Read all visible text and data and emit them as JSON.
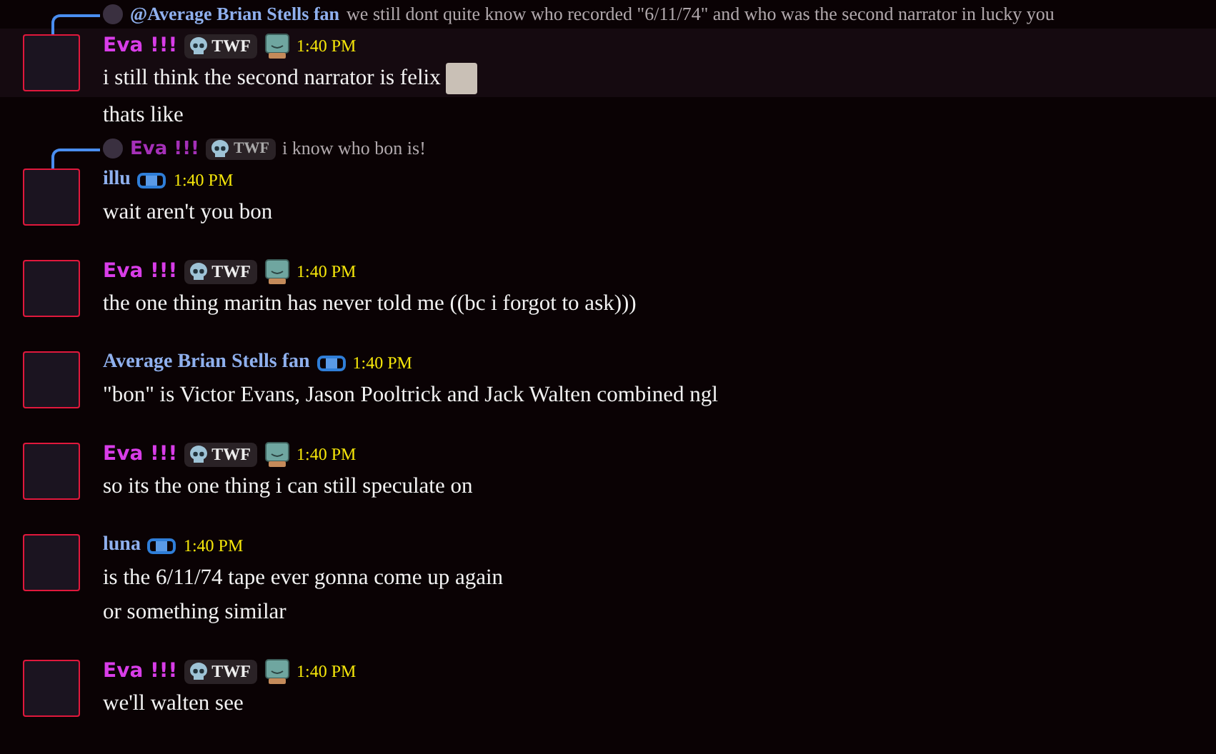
{
  "messages": [
    {
      "kind": "message",
      "hovered": true,
      "reply": {
        "author": "@Average Brian Stells fan",
        "color": "#8fb0ee",
        "text": "we still dont quite know who recorded \"6/11/74\" and who was the second narrator in lucky you"
      },
      "author": "Eva !!!",
      "color": "#d83de8",
      "tag": "TWF",
      "role_icon": {
        "kind": "monitor"
      },
      "time": "1:40 PM",
      "lines": [
        "i still think the second narrator is felix"
      ],
      "emoji": {
        "kind": "cat"
      }
    },
    {
      "kind": "continuation",
      "hovered": false,
      "lines": [
        "thats like"
      ]
    },
    {
      "kind": "message",
      "hovered": false,
      "reply": {
        "author": "Eva !!!",
        "color": "#a530b8",
        "tag": "TWF",
        "text": "i know who bon is!"
      },
      "author": "illu",
      "color": "#8fb0ee",
      "role_icon": {
        "kind": "bandage"
      },
      "time": "1:40 PM",
      "lines": [
        "wait aren't you bon"
      ]
    },
    {
      "kind": "message",
      "hovered": false,
      "author": "Eva !!!",
      "color": "#d83de8",
      "tag": "TWF",
      "role_icon": {
        "kind": "monitor"
      },
      "time": "1:40 PM",
      "lines": [
        "the one thing maritn has never told me ((bc i forgot to ask)))"
      ]
    },
    {
      "kind": "message",
      "hovered": false,
      "author": "Average Brian Stells fan",
      "color": "#8fb0ee",
      "role_icon": {
        "kind": "bandage"
      },
      "time": "1:40 PM",
      "lines": [
        "\"bon\" is Victor Evans, Jason Pooltrick and Jack Walten combined ngl"
      ]
    },
    {
      "kind": "message",
      "hovered": false,
      "author": "Eva !!!",
      "color": "#d83de8",
      "tag": "TWF",
      "role_icon": {
        "kind": "monitor"
      },
      "time": "1:40 PM",
      "lines": [
        "so its the one thing i can still speculate on"
      ]
    },
    {
      "kind": "message",
      "hovered": false,
      "author": "luna",
      "color": "#8fb0ee",
      "role_icon": {
        "kind": "bandage"
      },
      "time": "1:40 PM",
      "lines": [
        "is the 6/11/74 tape ever gonna come up again",
        "or something similar"
      ]
    },
    {
      "kind": "message",
      "hovered": false,
      "author": "Eva !!!",
      "color": "#d83de8",
      "tag": "TWF",
      "role_icon": {
        "kind": "monitor"
      },
      "time": "1:40 PM",
      "lines": [
        "we'll walten see"
      ]
    }
  ]
}
